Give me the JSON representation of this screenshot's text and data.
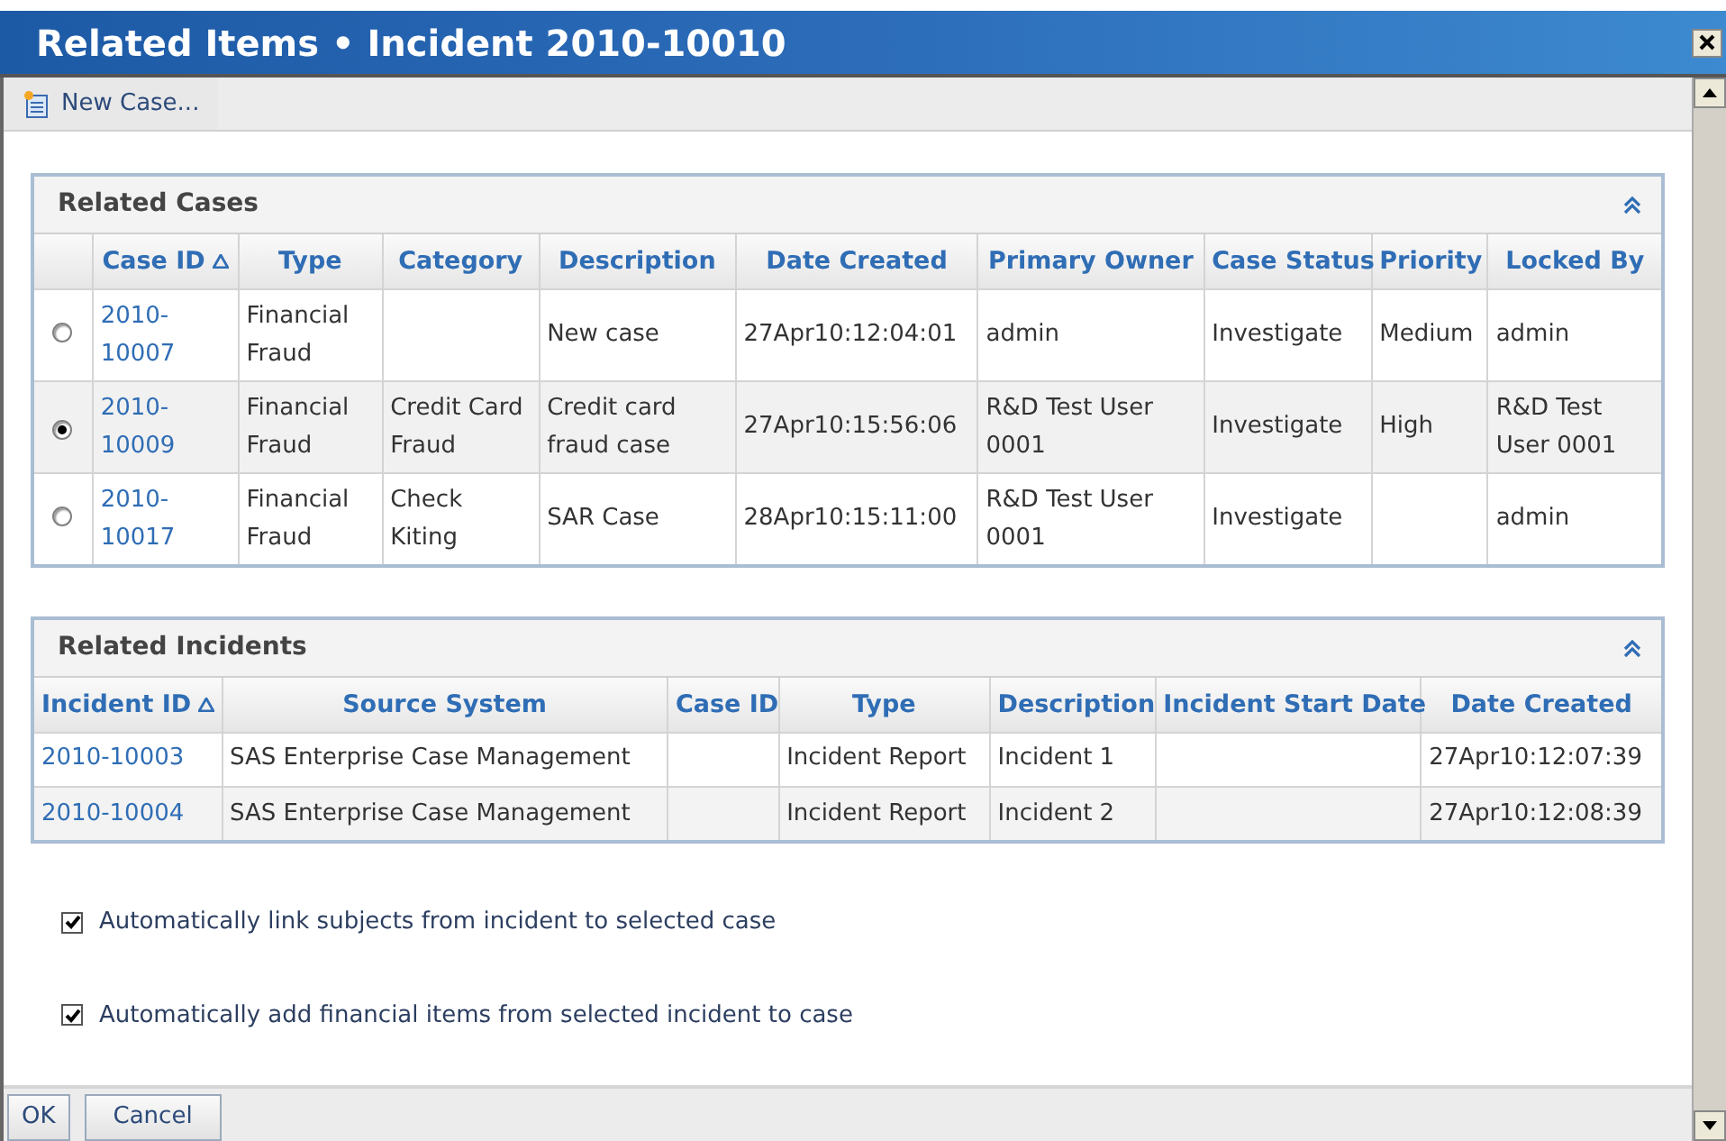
{
  "window": {
    "title": "Related Items • Incident 2010-10010"
  },
  "toolbar": [
    {
      "label": "New Case..."
    }
  ],
  "related_cases": {
    "title": "Related Cases",
    "expanded": true,
    "columns": [
      {
        "label": "Case ID",
        "sorted": true
      },
      {
        "label": "Type",
        "sorted": false
      },
      {
        "label": "Category",
        "sorted": false
      },
      {
        "label": "Description",
        "sorted": false
      },
      {
        "label": "Date Created",
        "sorted": false
      },
      {
        "label": "Primary Owner",
        "sorted": false
      },
      {
        "label": "Case Status",
        "sorted": false
      },
      {
        "label": "Priority",
        "sorted": false
      },
      {
        "label": "Locked By",
        "sorted": false
      }
    ],
    "rows": [
      {
        "selected": false,
        "cells": [
          "2010-10007",
          "Financial Fraud",
          "",
          "New case",
          "27Apr10:12:04:01",
          "admin",
          "Investigate",
          "Medium",
          "admin"
        ]
      },
      {
        "selected": true,
        "cells": [
          "2010-10009",
          "Financial Fraud",
          "Credit Card Fraud",
          "Credit card fraud case",
          "27Apr10:15:56:06",
          "R&D Test User 0001",
          "Investigate",
          "High",
          "R&D Test User 0001"
        ]
      },
      {
        "selected": false,
        "cells": [
          "2010-10017",
          "Financial Fraud",
          "Check Kiting",
          "SAR Case",
          "28Apr10:15:11:00",
          "R&D Test User 0001",
          "Investigate",
          "",
          "admin"
        ]
      }
    ]
  },
  "related_incidents": {
    "title": "Related Incidents",
    "expanded": true,
    "columns": [
      {
        "label": "Incident ID",
        "sorted": true
      },
      {
        "label": "Source System",
        "sorted": false
      },
      {
        "label": "Case ID",
        "sorted": false
      },
      {
        "label": "Type",
        "sorted": false
      },
      {
        "label": "Description",
        "sorted": false
      },
      {
        "label": "Incident Start Date",
        "sorted": false
      },
      {
        "label": "Date Created",
        "sorted": false
      }
    ],
    "rows": [
      {
        "cells": [
          "2010-10003",
          "SAS Enterprise Case Management",
          "",
          "Incident Report",
          "Incident 1",
          "",
          "27Apr10:12:07:39"
        ]
      },
      {
        "cells": [
          "2010-10004",
          "SAS Enterprise Case Management",
          "",
          "Incident Report",
          "Incident 2",
          "",
          "27Apr10:12:08:39"
        ]
      }
    ]
  },
  "options": [
    {
      "label": "Automatically link subjects from incident to selected case",
      "checked": true
    },
    {
      "label": "Automatically add financial items from selected incident to case",
      "checked": true
    }
  ],
  "buttons": [
    "OK",
    "Cancel"
  ]
}
